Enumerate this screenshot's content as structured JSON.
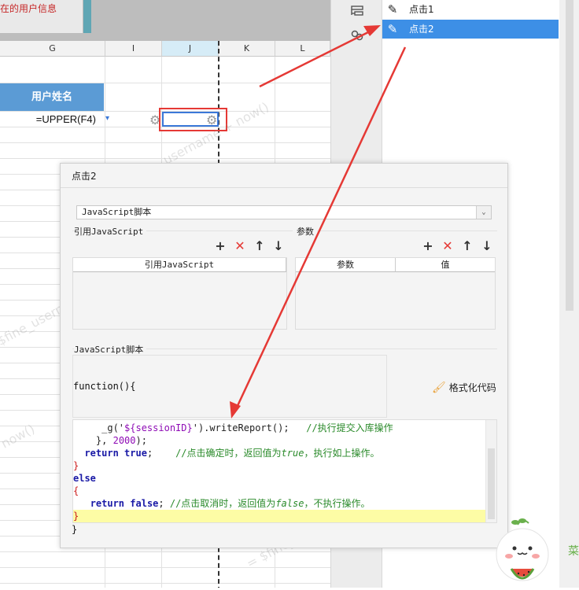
{
  "sheet": {
    "info_cell_text": "在的用户信息",
    "columns": [
      "G",
      "I",
      "J",
      "K",
      "L"
    ],
    "name_header": "用户姓名",
    "formula_cell": "=UPPER(F4)",
    "watermarks": [
      "username + now()",
      "$fine_username",
      "now()",
      "= $fine_u"
    ]
  },
  "events_panel": {
    "items": [
      {
        "label": "点击1",
        "icon": "pencil-icon",
        "selected": false
      },
      {
        "label": "点击2",
        "icon": "pencil-icon",
        "selected": true
      }
    ]
  },
  "dialog": {
    "title": "点击2",
    "type_select_value": "JavaScript脚本",
    "ref_js_label": "引用JavaScript",
    "ref_js_table_header": "引用JavaScript",
    "params_label": "参数",
    "params_table_headers": [
      "参数",
      "值"
    ],
    "js_script_label": "JavaScript脚本",
    "function_decl": "function(){",
    "format_button": "格式化代码",
    "code_lines": [
      {
        "indent": "     ",
        "parts": [
          [
            "p",
            "_g('"
          ],
          [
            "s",
            "${sessionID}"
          ],
          [
            "p",
            "').writeReport();   "
          ],
          [
            "c",
            "//执行提交入库操作"
          ]
        ]
      },
      {
        "indent": "    ",
        "parts": [
          [
            "p",
            "}, "
          ],
          [
            "n",
            "2000"
          ],
          [
            "p",
            ");"
          ]
        ]
      },
      {
        "indent": "  ",
        "parts": [
          [
            "k",
            "return"
          ],
          [
            "p",
            " "
          ],
          [
            "k",
            "true"
          ],
          [
            "p",
            ";    "
          ],
          [
            "c",
            "//点击确定时，返回值为"
          ],
          [
            "ci",
            "true"
          ],
          [
            "c",
            "，执行如上操作。"
          ]
        ]
      },
      {
        "indent": "",
        "parts": [
          [
            "r",
            "}"
          ]
        ]
      },
      {
        "indent": "",
        "parts": [
          [
            "k",
            "else"
          ]
        ]
      },
      {
        "indent": "",
        "parts": [
          [
            "r",
            "{"
          ]
        ]
      },
      {
        "indent": "   ",
        "parts": [
          [
            "k",
            "return"
          ],
          [
            "p",
            " "
          ],
          [
            "k",
            "false"
          ],
          [
            "p",
            "; "
          ],
          [
            "c",
            "//点击取消时，返回值为"
          ],
          [
            "ci",
            "false"
          ],
          [
            "c",
            "，不执行操作。"
          ]
        ]
      },
      {
        "indent": "",
        "parts": [
          [
            "r",
            "}"
          ]
        ]
      }
    ],
    "function_close": "}"
  },
  "mascot_text": "菜"
}
